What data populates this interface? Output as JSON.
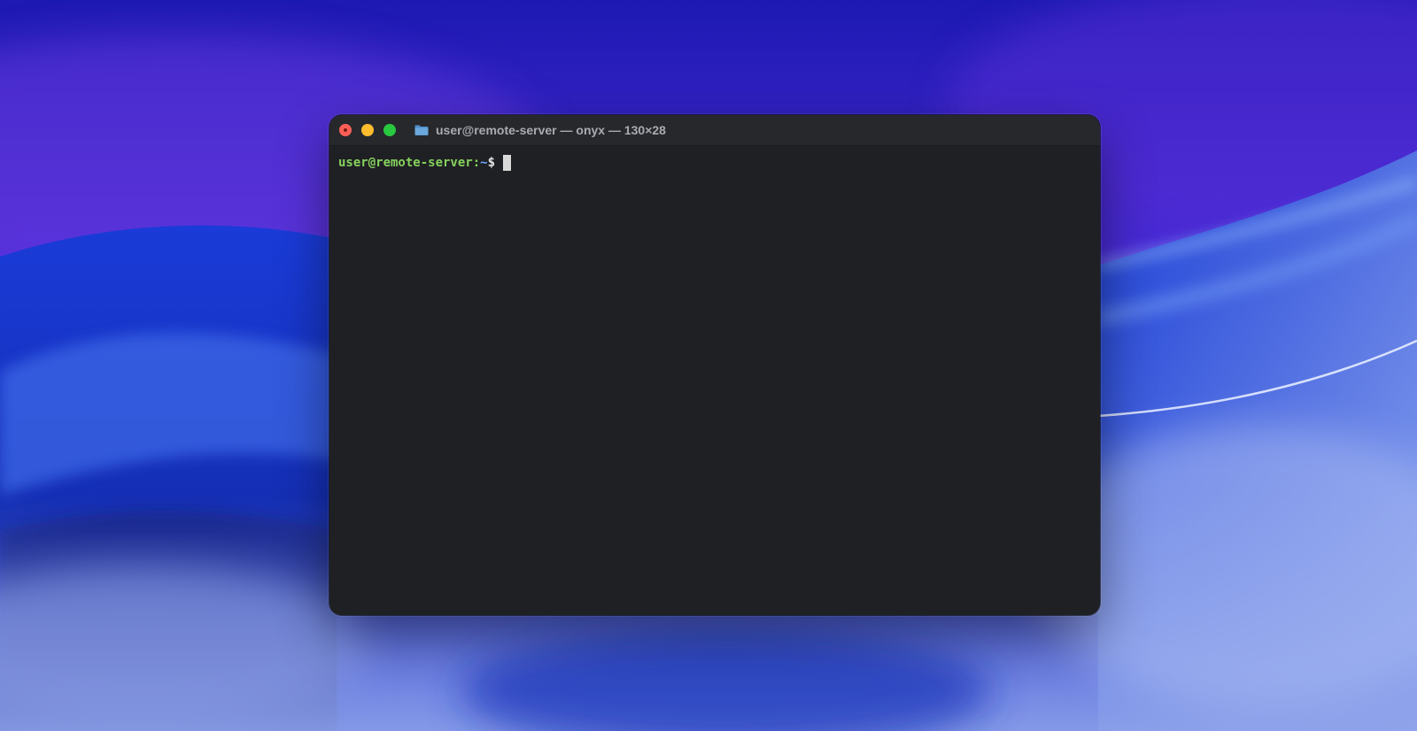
{
  "window": {
    "title": "user@remote-server — onyx — 130×28",
    "folder_icon": "folder-icon"
  },
  "traffic_lights": {
    "close": "#ff5f57",
    "minimize": "#febc2e",
    "zoom": "#28c840"
  },
  "terminal": {
    "prompt_user_host": "user@remote-server",
    "prompt_separator": ":",
    "prompt_path": "~",
    "prompt_symbol": "$",
    "input_value": ""
  },
  "colors": {
    "terminal_bg": "#1f2023",
    "prompt_green": "#86d15e",
    "prompt_blue": "#6ea6ff"
  }
}
